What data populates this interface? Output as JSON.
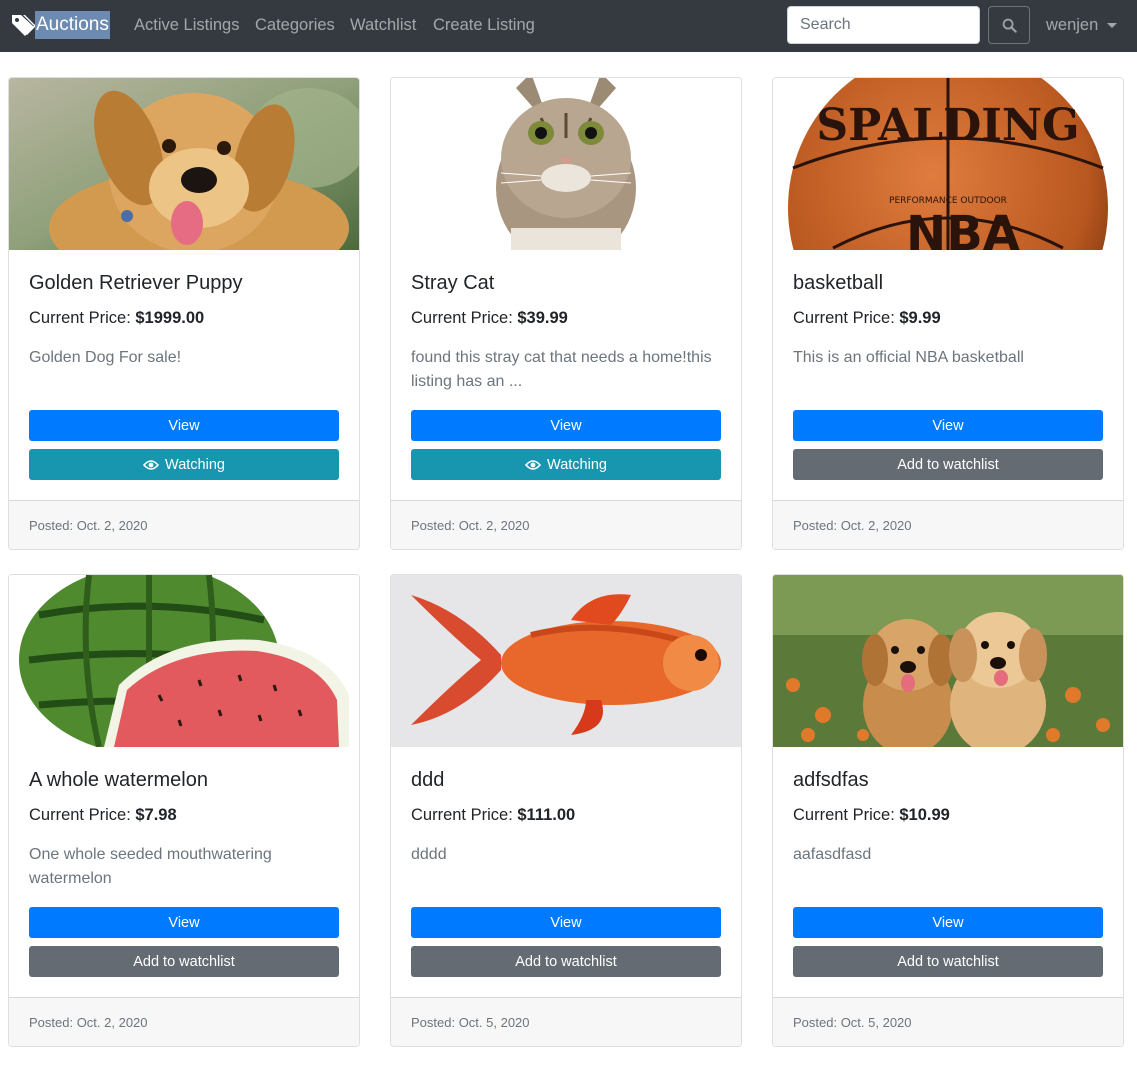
{
  "navbar": {
    "brand": "Auctions",
    "links": [
      "Active Listings",
      "Categories",
      "Watchlist",
      "Create Listing"
    ],
    "search_placeholder": "Search",
    "user": "wenjen"
  },
  "listings": [
    {
      "title": "Golden Retriever Puppy",
      "price_label": "Current Price:",
      "price": "$1999.00",
      "description": "Golden Dog For sale!",
      "view_label": "View",
      "watch_label": "Watching",
      "watching": true,
      "posted": "Posted: Oct. 2, 2020"
    },
    {
      "title": "Stray Cat",
      "price_label": "Current Price:",
      "price": "$39.99",
      "description": "found this stray cat that needs a home!this listing has an ...",
      "view_label": "View",
      "watch_label": "Watching",
      "watching": true,
      "posted": "Posted: Oct. 2, 2020"
    },
    {
      "title": "basketball",
      "price_label": "Current Price:",
      "price": "$9.99",
      "description": "This is an official NBA basketball",
      "view_label": "View",
      "watch_label": "Add to watchlist",
      "watching": false,
      "posted": "Posted: Oct. 2, 2020",
      "image_text": [
        "SPALDING",
        "PERFORMANCE OUTDOOR",
        "NBA"
      ]
    },
    {
      "title": "A whole watermelon",
      "price_label": "Current Price:",
      "price": "$7.98",
      "description": "One whole seeded mouthwatering watermelon",
      "view_label": "View",
      "watch_label": "Add to watchlist",
      "watching": false,
      "posted": "Posted: Oct. 2, 2020"
    },
    {
      "title": "ddd",
      "price_label": "Current Price:",
      "price": "$111.00",
      "description": "dddd",
      "view_label": "View",
      "watch_label": "Add to watchlist",
      "watching": false,
      "posted": "Posted: Oct. 5, 2020"
    },
    {
      "title": "adfsdfas",
      "price_label": "Current Price:",
      "price": "$10.99",
      "description": "aafasdfasd",
      "view_label": "View",
      "watch_label": "Add to watchlist",
      "watching": false,
      "posted": "Posted: Oct. 5, 2020"
    }
  ],
  "colors": {
    "navbar_bg": "#343a40",
    "primary": "#007bff",
    "info": "#1996af",
    "secondary": "#646b72"
  }
}
